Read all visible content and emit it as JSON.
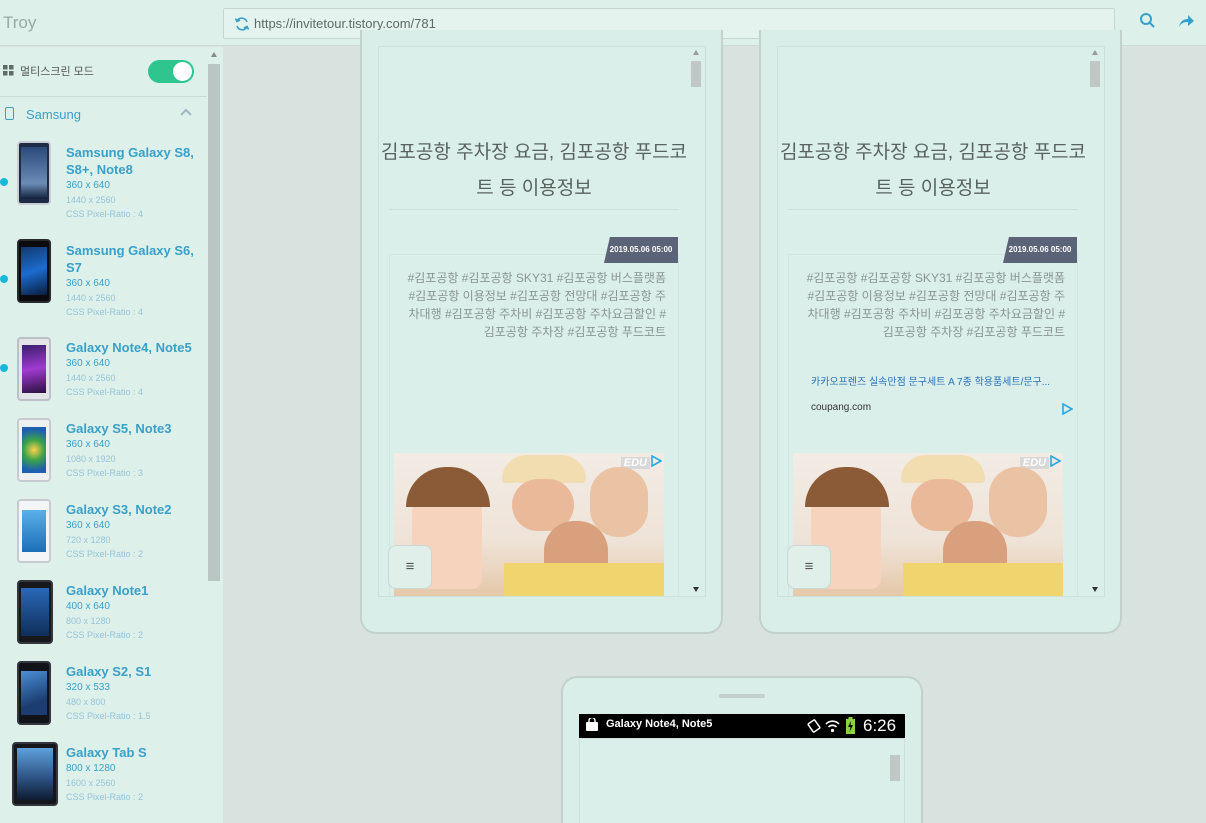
{
  "app": {
    "title": "Troy"
  },
  "address_bar": {
    "url": "https://invitetour.tistory.com/781"
  },
  "sidebar": {
    "multiscreen_label": "멀티스크린 모드",
    "multiscreen_enabled": true,
    "group": {
      "label": "Samsung",
      "expanded": true
    },
    "devices": [
      {
        "name": "Samsung Galaxy S8, S8+, Note8",
        "res": "360 x 640",
        "phys": "1440 x 2560",
        "ratio": "CSS Pixel-Ratio : 4",
        "selected": true
      },
      {
        "name": "Samsung Galaxy S6, S7",
        "res": "360 x 640",
        "phys": "1440 x 2560",
        "ratio": "CSS Pixel-Ratio : 4",
        "selected": true
      },
      {
        "name": "Galaxy Note4, Note5",
        "res": "360 x 640",
        "phys": "1440 x 2560",
        "ratio": "CSS Pixel-Ratio : 4",
        "selected": true
      },
      {
        "name": "Galaxy S5, Note3",
        "res": "360 x 640",
        "phys": "1080 x 1920",
        "ratio": "CSS Pixel-Ratio : 3",
        "selected": false
      },
      {
        "name": "Galaxy S3, Note2",
        "res": "360 x 640",
        "phys": "720 x 1280",
        "ratio": "CSS Pixel-Ratio : 2",
        "selected": false
      },
      {
        "name": "Galaxy Note1",
        "res": "400 x 640",
        "phys": "800 x 1280",
        "ratio": "CSS Pixel-Ratio : 2",
        "selected": false
      },
      {
        "name": "Galaxy S2, S1",
        "res": "320 x 533",
        "phys": "480 x 800",
        "ratio": "CSS Pixel-Ratio : 1.5",
        "selected": false
      },
      {
        "name": "Galaxy Tab S",
        "res": "800 x 1280",
        "phys": "1600 x 2560",
        "ratio": "CSS Pixel-Ratio : 2",
        "selected": false
      }
    ]
  },
  "frames": [
    {
      "post_title": "김포공항 주차장 요금, 김포공항 푸드코트 등 이용정보",
      "date": "2019.05.06 05:00",
      "tags": "#김포공항  #김포공항 SKY31  #김포공항 버스플랫폼  #김포공항 이용정보  #김포공항 전망대  #김포공항 주차대행  #김포공항 주차비  #김포공항 주차요금할인  #김포공항 주차장  #김포공항 푸드코트",
      "ad_label": "EDU",
      "menu_icon": "≡"
    },
    {
      "post_title": "김포공항 주차장 요금, 김포공항 푸드코트 등 이용정보",
      "date": "2019.05.06 05:00",
      "tags": "#김포공항  #김포공항 SKY31  #김포공항 버스플랫폼  #김포공항 이용정보  #김포공항 전망대  #김포공항 주차대행  #김포공항 주차비  #김포공항 주차요금할인  #김포공항 주차장  #김포공항 푸드코트",
      "ad_text": "카카오프렌즈 실속만점 문구세트 A 7종 학용품세트/문구...",
      "ad_domain": "coupang.com",
      "ad_label": "EDU",
      "menu_icon": "≡"
    }
  ],
  "bottom_frame": {
    "status_title": "Galaxy Note4, Note5",
    "clock": "6:26"
  },
  "colors": {
    "accent": "#39a0c8",
    "toggle": "#2ec58f",
    "dot": "#14b9d9",
    "date_tag": "#5b6378"
  }
}
